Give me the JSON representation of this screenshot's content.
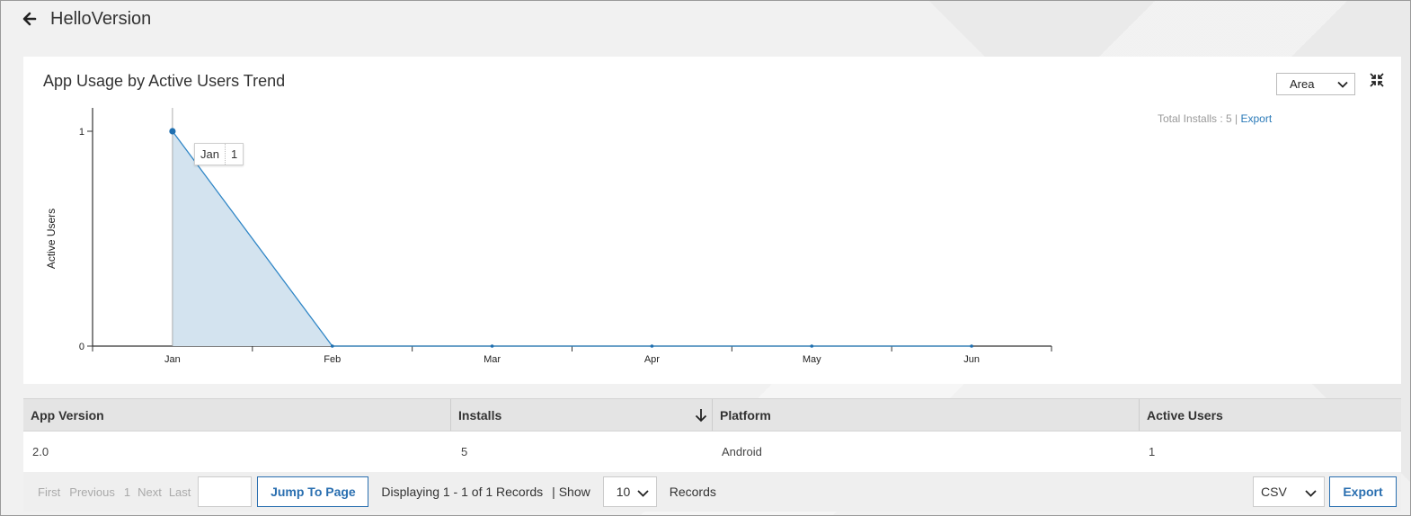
{
  "app": {
    "title": "HelloVersion"
  },
  "chart_card": {
    "title": "App Usage by Active Users Trend",
    "chart_type_selected": "Area",
    "summary": {
      "text": "Total Installs : 5 | ",
      "export_label": "Export"
    },
    "tooltip": {
      "label": "Jan",
      "value": "1"
    }
  },
  "chart_data": {
    "type": "area",
    "title": "App Usage by Active Users Trend",
    "xlabel": "",
    "ylabel": "Active Users",
    "categories": [
      "Jan",
      "Feb",
      "Mar",
      "Apr",
      "May",
      "Jun"
    ],
    "series": [
      {
        "values": [
          1,
          0,
          0,
          0,
          0,
          0
        ]
      }
    ],
    "ylim": [
      0,
      1
    ],
    "yticks": [
      0,
      1
    ],
    "grid": false,
    "colors": {
      "line": "#2f86c6",
      "fill": "#d3e3ef",
      "point": "#1f6fb0"
    }
  },
  "table": {
    "columns": [
      "App Version",
      "Installs",
      "Platform",
      "Active Users"
    ],
    "rows": [
      [
        "2.0",
        "5",
        "Android",
        "1"
      ]
    ]
  },
  "pager": {
    "first": "First",
    "previous": "Previous",
    "page": "1",
    "next": "Next",
    "last": "Last",
    "jump_label": "Jump To Page",
    "display_text": "Displaying 1 - 1 of 1 Records",
    "show_text": "| Show",
    "page_size": "10",
    "records_text": "Records",
    "format": "CSV",
    "export_label": "Export"
  }
}
